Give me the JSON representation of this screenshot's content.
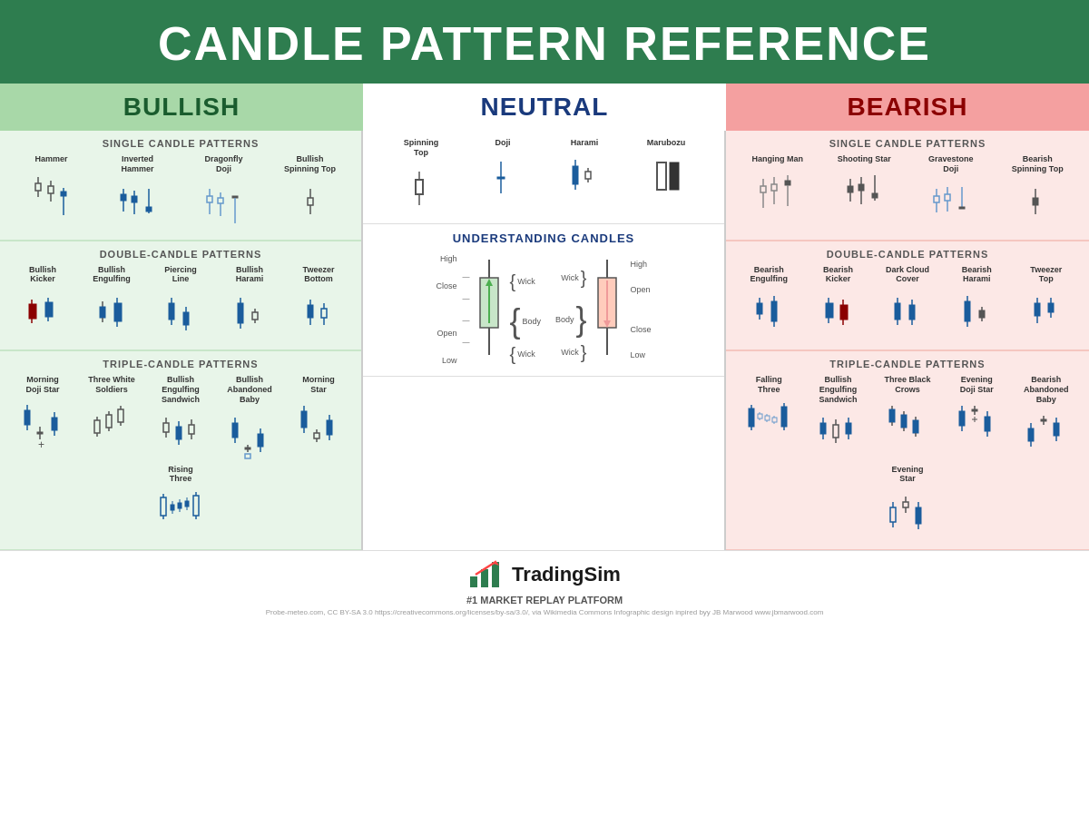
{
  "header": {
    "title": "CANDLE PATTERN REFERENCE"
  },
  "categories": {
    "bullish": {
      "label": "BULLISH",
      "color": "#1a5c2e"
    },
    "neutral": {
      "label": "NEUTRAL",
      "color": "#1a3a7c"
    },
    "bearish": {
      "label": "BEARISH",
      "color": "#8b0000"
    }
  },
  "bullish": {
    "single_title": "SINGLE CANDLE PATTERNS",
    "single_patterns": [
      {
        "name": "Hammer"
      },
      {
        "name": "Inverted\nHammer"
      },
      {
        "name": "Dragonfly\nDoji"
      },
      {
        "name": "Bullish\nSpinning Top"
      }
    ],
    "double_title": "DOUBLE-CANDLE PATTERNS",
    "double_patterns": [
      {
        "name": "Bullish\nKicker"
      },
      {
        "name": "Bullish\nEngulfing"
      },
      {
        "name": "Piercing\nLine"
      },
      {
        "name": "Bullish\nHarami"
      },
      {
        "name": "Tweezer\nBottom"
      }
    ],
    "triple_title": "TRIPLE-CANDLE PATTERNS",
    "triple_patterns": [
      {
        "name": "Morning\nDoji Star"
      },
      {
        "name": "Three White\nSoldiers"
      },
      {
        "name": "Bullish\nEngulfing\nSandwich"
      },
      {
        "name": "Bullish\nAbandoned\nBaby"
      },
      {
        "name": "Morning\nStar"
      },
      {
        "name": "Rising\nThree"
      }
    ]
  },
  "neutral": {
    "single_title": "SINGLE CANDLE PATTERNS",
    "single_patterns": [
      {
        "name": "Spinning\nTop"
      },
      {
        "name": "Doji"
      },
      {
        "name": "Harami"
      },
      {
        "name": "Marubozu"
      }
    ],
    "understanding_title": "UNDERSTANDING CANDLES"
  },
  "bearish": {
    "single_title": "SINGLE CANDLE PATTERNS",
    "single_patterns": [
      {
        "name": "Hanging Man"
      },
      {
        "name": "Shooting Star"
      },
      {
        "name": "Gravestone\nDoji"
      },
      {
        "name": "Bearish\nSpinning Top"
      }
    ],
    "double_title": "DOUBLE-CANDLE PATTERNS",
    "double_patterns": [
      {
        "name": "Bearish\nEngulfing"
      },
      {
        "name": "Bearish\nKicker"
      },
      {
        "name": "Dark Cloud\nCover"
      },
      {
        "name": "Bearish\nHarami"
      },
      {
        "name": "Tweezer\nTop"
      }
    ],
    "triple_title": "TRIPLE-CANDLE PATTERNS",
    "triple_patterns": [
      {
        "name": "Falling\nThree"
      },
      {
        "name": "Bullish\nEngulfing\nSandwich"
      },
      {
        "name": "Three Black\nCrows"
      },
      {
        "name": "Evening\nDoji Star"
      },
      {
        "name": "Bearish\nAbandoned\nBaby"
      },
      {
        "name": "Evening\nStar"
      }
    ]
  },
  "footer": {
    "logo_text": "TradingSim",
    "tagline": "#1 MARKET REPLAY PLATFORM",
    "credits": "Probe-meteo.com, CC BY-SA 3.0 https://creativecommons.org/licenses/by-sa/3.0/, via Wikimedia Commons     Infographic design inpired byy JB Marwood www.jbmarwood.com"
  }
}
